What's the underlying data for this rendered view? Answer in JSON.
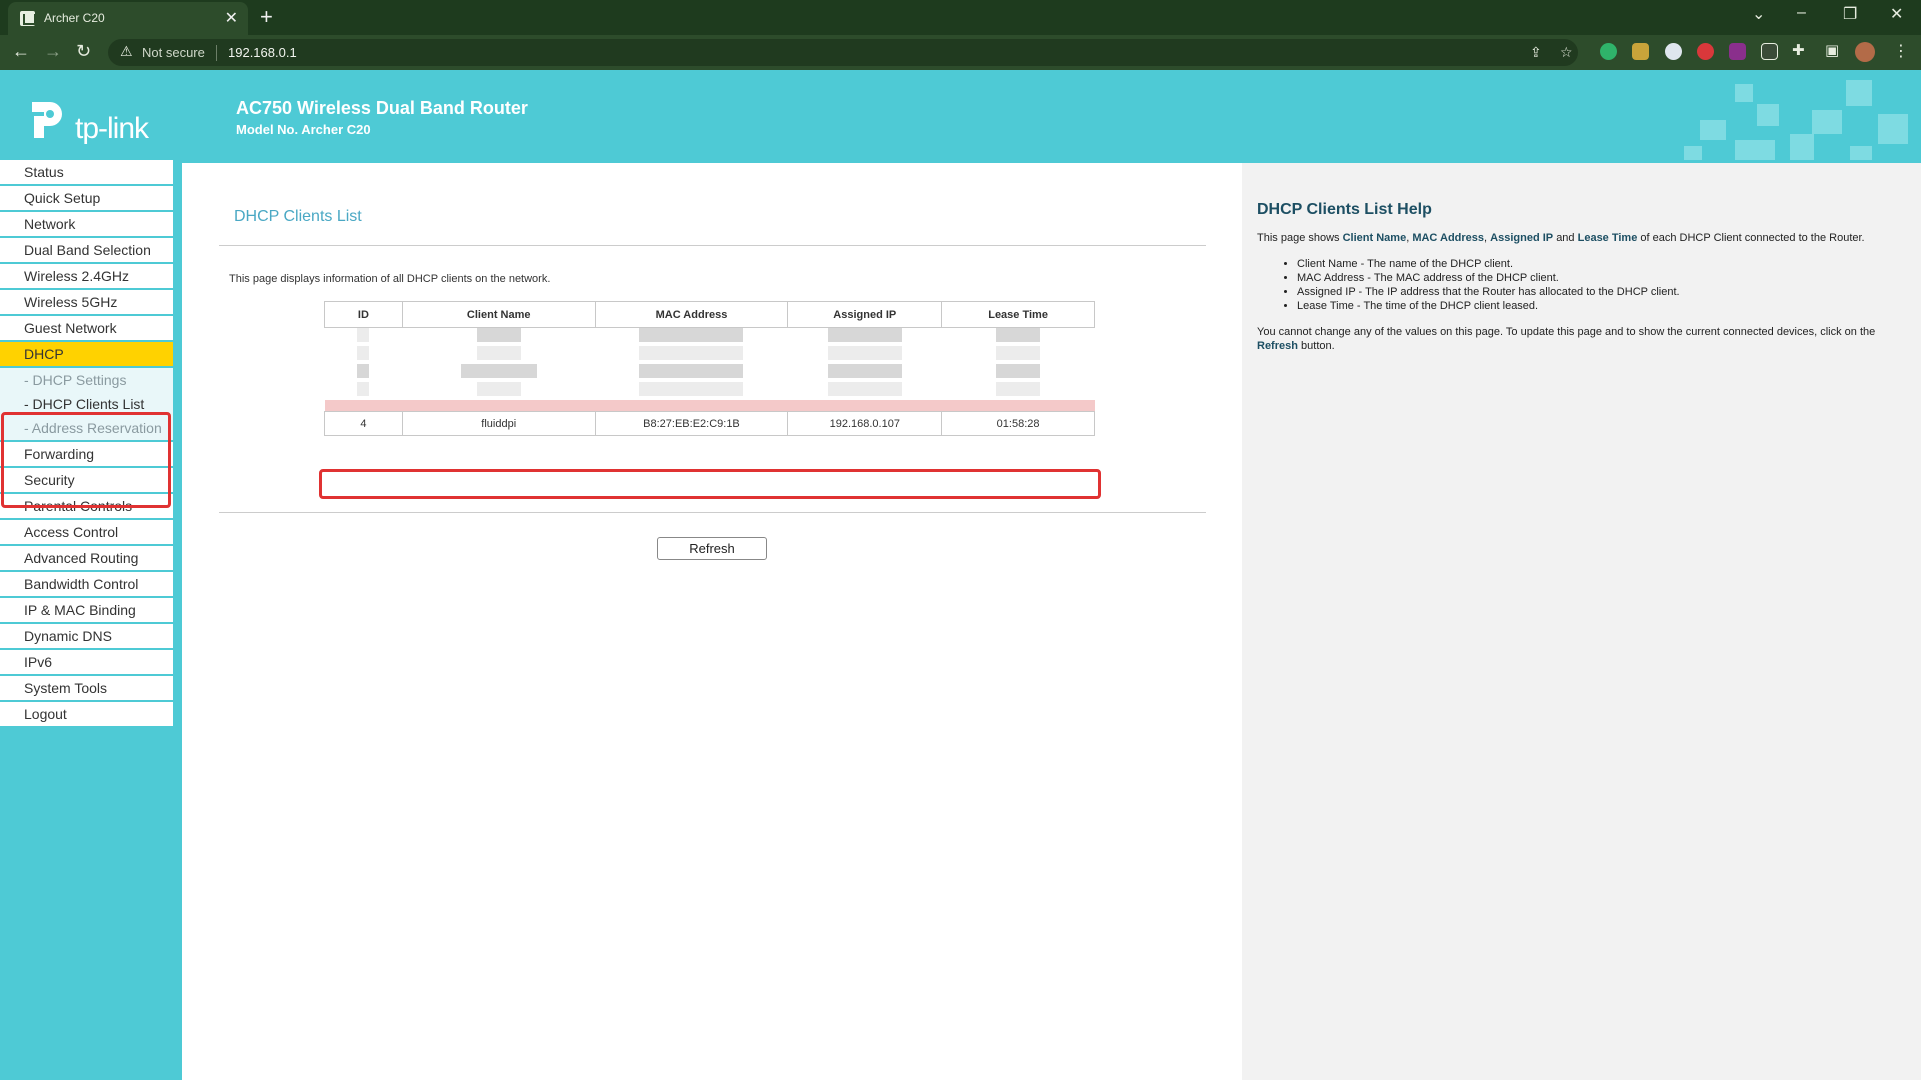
{
  "browser": {
    "tab_title": "Archer C20",
    "security_label": "Not secure",
    "url": "192.168.0.1"
  },
  "header": {
    "logo_text": "tp-link",
    "title": "AC750 Wireless Dual Band Router",
    "model": "Model No. Archer C20"
  },
  "sidebar": {
    "items_top": [
      "Status",
      "Quick Setup",
      "Network",
      "Dual Band Selection",
      "Wireless 2.4GHz",
      "Wireless 5GHz",
      "Guest Network"
    ],
    "active": "DHCP",
    "sub_items": [
      "- DHCP Settings",
      "- DHCP Clients List",
      "- Address Reservation"
    ],
    "items_bottom": [
      "Forwarding",
      "Security",
      "Parental Controls",
      "Access Control",
      "Advanced Routing",
      "Bandwidth Control",
      "IP & MAC Binding",
      "Dynamic DNS",
      "IPv6",
      "System Tools",
      "Logout"
    ]
  },
  "main": {
    "title": "DHCP Clients List",
    "description": "This page displays information of all DHCP clients on the network.",
    "columns": [
      "ID",
      "Client Name",
      "MAC Address",
      "Assigned IP",
      "Lease Time"
    ],
    "visible_row": {
      "id": "4",
      "client_name": "fluiddpi",
      "mac": "B8:27:EB:E2:C9:1B",
      "ip": "192.168.0.107",
      "lease": "01:58:28"
    },
    "refresh_label": "Refresh"
  },
  "help": {
    "title": "DHCP Clients List Help",
    "intro_prefix": "This page shows",
    "kw_client_name": "Client Name",
    "kw_mac": "MAC Address",
    "kw_ip": "Assigned IP",
    "intro_and": "and",
    "kw_lease": "Lease Time",
    "intro_suffix": "of each DHCP Client connected to the Router.",
    "bullets": [
      "Client Name - The name of the DHCP client.",
      "MAC Address - The MAC address of the DHCP client.",
      "Assigned IP - The IP address that the Router has allocated to the DHCP client.",
      "Lease Time - The time of the DHCP client leased."
    ],
    "note_prefix": "You cannot change any of the values on this page. To update this page and to show the current connected devices, click on the",
    "kw_refresh": "Refresh",
    "note_suffix": "button."
  },
  "colors": {
    "brand_teal": "#4ecad5",
    "active_yellow": "#ffd200",
    "highlight_red": "#e03232"
  }
}
